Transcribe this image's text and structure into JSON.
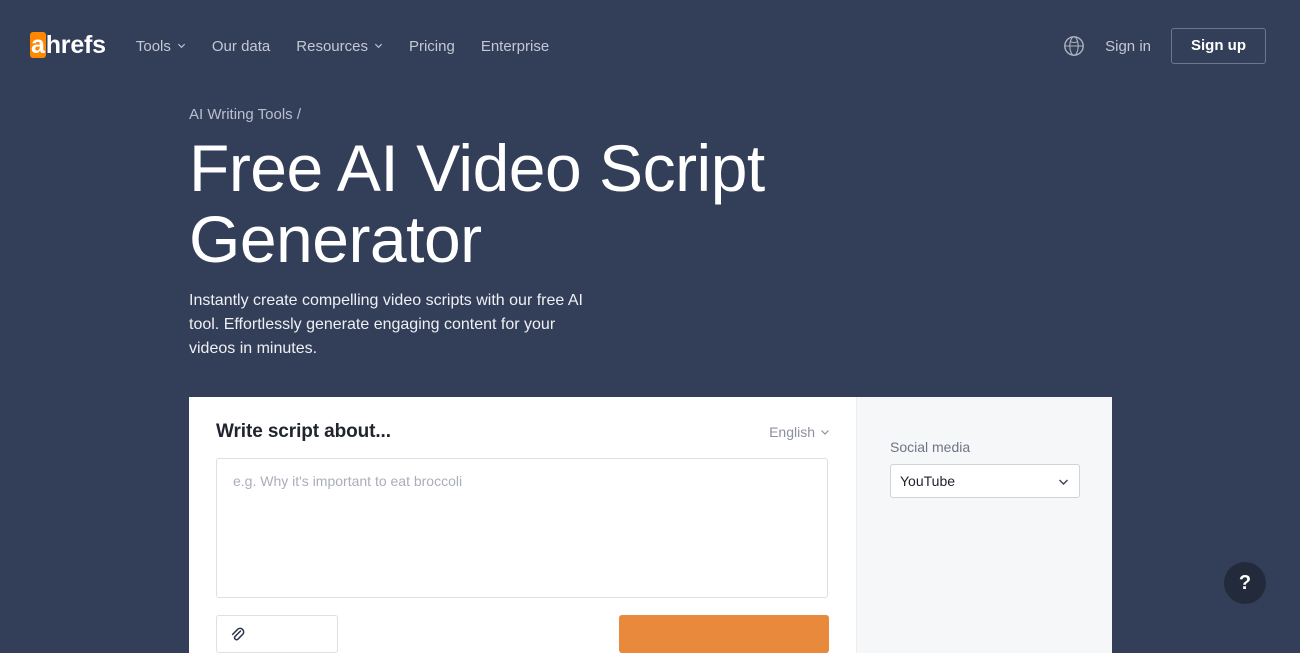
{
  "nav": {
    "logo": {
      "accent_letter": "a",
      "rest": "hrefs",
      "accent_color": "#ff8800"
    },
    "links": [
      {
        "label": "Tools",
        "has_caret": true
      },
      {
        "label": "Our data",
        "has_caret": false
      },
      {
        "label": "Resources",
        "has_caret": true
      },
      {
        "label": "Pricing",
        "has_caret": false
      },
      {
        "label": "Enterprise",
        "has_caret": false
      }
    ],
    "language_icon": "globe-icon",
    "sign_in": "Sign in",
    "sign_up": "Sign up"
  },
  "hero": {
    "breadcrumb": "AI Writing Tools /",
    "title": "Free AI Video Script Generator",
    "subtitle": "Instantly create compelling video scripts with our free AI tool. Effortlessly generate engaging content for your videos in minutes."
  },
  "form": {
    "title": "Write script about...",
    "language_label": "English",
    "textarea_placeholder": "e.g. Why it's important to eat broccoli",
    "textarea_value": "",
    "attach_label": "",
    "attach_icon": "paperclip-icon",
    "generate_label": "",
    "accent_color": "#e8893c"
  },
  "side": {
    "label": "Social media",
    "selected": "YouTube",
    "options": [
      "YouTube"
    ]
  },
  "help": {
    "label": "?"
  }
}
